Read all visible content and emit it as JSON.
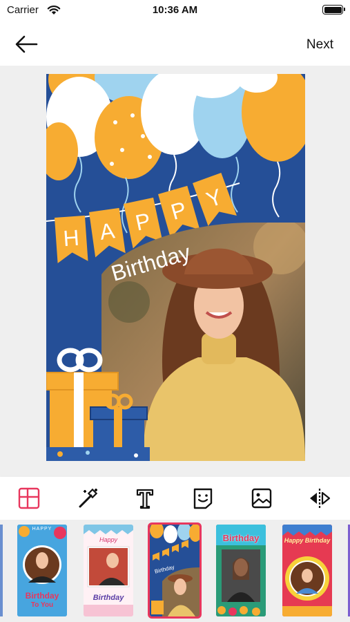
{
  "status_bar": {
    "carrier": "Carrier",
    "time": "10:36 AM"
  },
  "nav": {
    "back_icon": "arrow-left-icon",
    "next_label": "Next"
  },
  "card": {
    "banner_letters": [
      "H",
      "A",
      "P",
      "P",
      "Y"
    ],
    "subtitle": "Birthday"
  },
  "toolbar": {
    "tools": [
      {
        "icon": "layout-grid-icon",
        "active": true
      },
      {
        "icon": "magic-wand-icon",
        "active": false
      },
      {
        "icon": "text-icon",
        "active": false
      },
      {
        "icon": "sticker-icon",
        "active": false
      },
      {
        "icon": "image-icon",
        "active": false
      },
      {
        "icon": "flip-icon",
        "active": false
      }
    ],
    "active_color": "#e8365d"
  },
  "templates": [
    {
      "title_top": "HAPPY",
      "title": "Birthday",
      "subtitle": "To You"
    },
    {
      "title_top": "Happy",
      "title": "Birthday"
    },
    {
      "title_top": "HAPPY",
      "title": "Birthday",
      "selected": true
    },
    {
      "title": "Birthday"
    },
    {
      "title": "Happy Birthday"
    }
  ],
  "colors": {
    "accent": "#e8365d",
    "card_blue": "#254f97",
    "banner_orange": "#f7ac32"
  }
}
